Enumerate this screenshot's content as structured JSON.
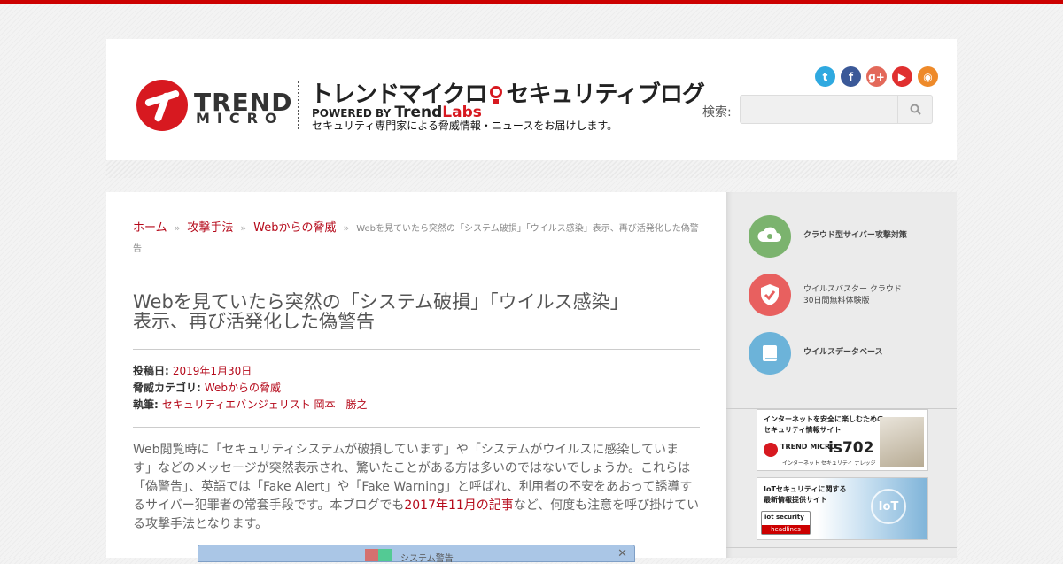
{
  "colors": {
    "accent": "#b5091a",
    "brand_red": "#d71920",
    "topbar": "#cc0000"
  },
  "header": {
    "logo_trend": "TREND",
    "logo_micro": "MICRO",
    "blog_title_pre": "トレンドマイクロ",
    "blog_title_post": "セキュリティブログ",
    "powered_by": "POWERED BY",
    "trendlabs_a": "Trend",
    "trendlabs_b": "Labs",
    "tagline": "セキュリティ専門家による脅威情報・ニュースをお届けします。",
    "search_label": "検索:",
    "search_value": "",
    "social": [
      {
        "icon": "twitter-icon",
        "glyph": "t",
        "color": "#2fa9e0"
      },
      {
        "icon": "facebook-icon",
        "glyph": "f",
        "color": "#3b5998"
      },
      {
        "icon": "google-plus-icon",
        "glyph": "g+",
        "color": "#e3695a"
      },
      {
        "icon": "youtube-icon",
        "glyph": "▶",
        "color": "#e02f2f"
      },
      {
        "icon": "rss-icon",
        "glyph": "◉",
        "color": "#ee8a2a"
      }
    ]
  },
  "breadcrumb": {
    "home": "ホーム",
    "sep": "»",
    "cat1": "攻撃手法",
    "cat2": "Webからの脅威",
    "current": "Webを見ていたら突然の「システム破損」「ウイルス感染」表示、再び活発化した偽警告"
  },
  "article": {
    "title_line1": "Webを見ていたら突然の「システム破損」「ウイルス感染」",
    "title_line2": "表示、再び活発化した偽警告",
    "meta_posted_label": "投稿日:",
    "meta_posted_value": "2019年1月30日",
    "meta_category_label": "脅威カテゴリ:",
    "meta_category_value": "Webからの脅威",
    "meta_author_label": "執筆:",
    "meta_author_value": "セキュリティエバンジェリスト 岡本　勝之",
    "body_part1": "Web閲覧時に「セキュリティシステムが破損しています」や「システムがウイルスに感染していま す」などのメッセージが突然表示され、驚いたことがある方は多いのではないでしょうか。これらは「偽警告」、英語では「Fake Alert」や「Fake Warning」と呼ばれ、利用者の不安をあおって誘導するサイバー犯罪者の常套手段です。本ブログでも",
    "body_link": "2017年11月の記事",
    "body_part2": "など、何度も注意を呼び掛けている攻撃手法となります。",
    "screenshot_title": "システム警告"
  },
  "sidebar": {
    "items": [
      {
        "icon": "cloud-radiation-icon",
        "label": "クラウド型サイバー攻撃対策",
        "color": "#7bb36e"
      },
      {
        "icon": "shield-check-icon",
        "label1": "ウイルスバスター クラウド",
        "label2": "30日間無料体験版",
        "color": "#e8605f"
      },
      {
        "icon": "book-icon",
        "label": "ウイルスデータベース",
        "color": "#6cb3d9"
      }
    ],
    "banner1": {
      "line1": "インターネットを安全に楽しむための",
      "line2": "セキュリティ情報サイト",
      "brand": "is702",
      "sub": "インターネット セキュリティ ナレッジ",
      "logo": "TREND MICRO"
    },
    "banner2": {
      "line1": "IoTセキュリティに関する",
      "line2": "最新情報提供サイト",
      "iot": "IoT",
      "brand1": "iot security",
      "brand2": "headlines"
    }
  }
}
